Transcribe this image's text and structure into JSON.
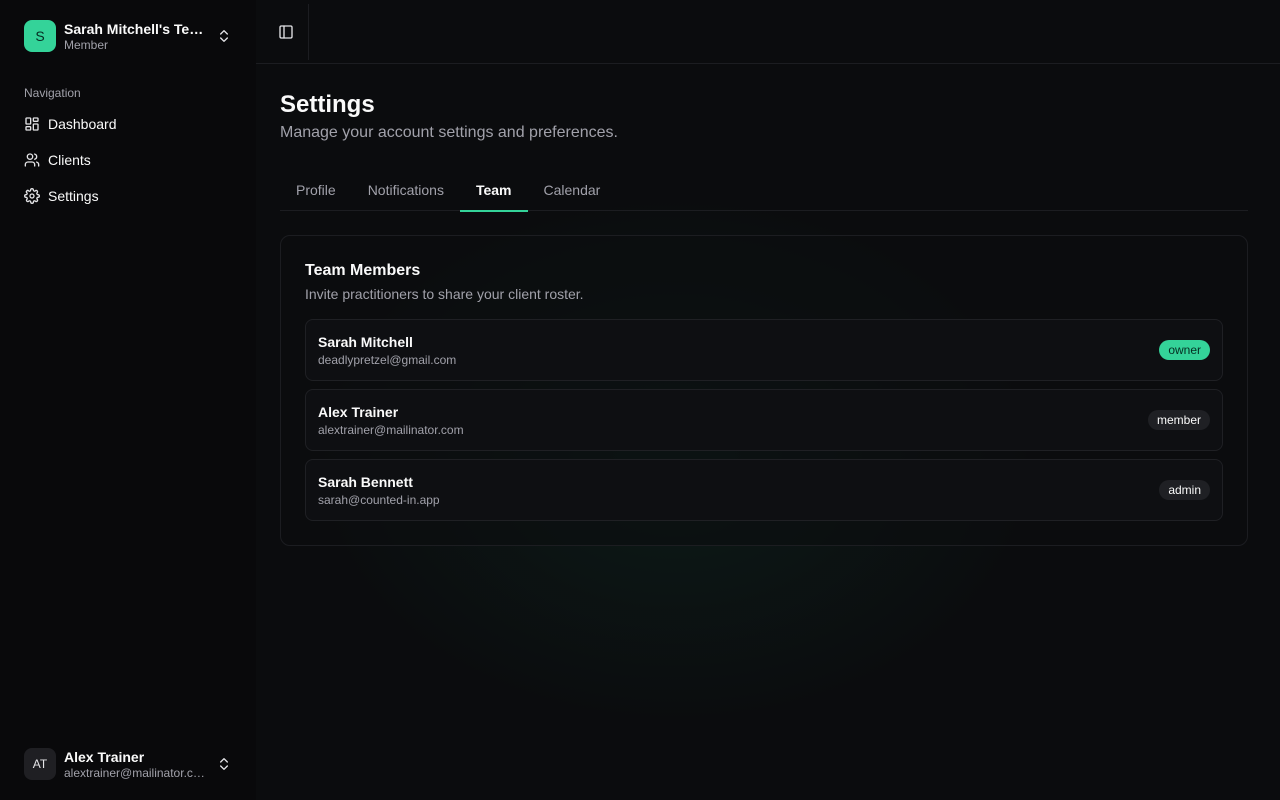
{
  "colors": {
    "accent": "#34d399",
    "background": "#09090b",
    "muted_text": "#a1a1aa",
    "border": "#1c1d21"
  },
  "workspace": {
    "avatar_letter": "S",
    "name": "Sarah Mitchell's Team",
    "role": "Member",
    "switch_icon": "chevrons-up-down-icon"
  },
  "nav": {
    "label": "Navigation",
    "items": [
      {
        "label": "Dashboard",
        "icon": "layout-dashboard-icon"
      },
      {
        "label": "Clients",
        "icon": "users-icon"
      },
      {
        "label": "Settings",
        "icon": "gear-icon"
      }
    ]
  },
  "user": {
    "initials": "AT",
    "name": "Alex Trainer",
    "email": "alextrainer@mailinator.com"
  },
  "topbar": {
    "toggle_icon": "panel-left-icon"
  },
  "page": {
    "title": "Settings",
    "subtitle": "Manage your account settings and preferences."
  },
  "tabs": [
    {
      "label": "Profile",
      "active": false
    },
    {
      "label": "Notifications",
      "active": false
    },
    {
      "label": "Team",
      "active": true
    },
    {
      "label": "Calendar",
      "active": false
    }
  ],
  "team": {
    "title": "Team Members",
    "subtitle": "Invite practitioners to share your client roster.",
    "members": [
      {
        "name": "Sarah Mitchell",
        "email": "deadlypretzel@gmail.com",
        "role": "owner"
      },
      {
        "name": "Alex Trainer",
        "email": "alextrainer@mailinator.com",
        "role": "member"
      },
      {
        "name": "Sarah Bennett",
        "email": "sarah@counted-in.app",
        "role": "admin"
      }
    ]
  }
}
